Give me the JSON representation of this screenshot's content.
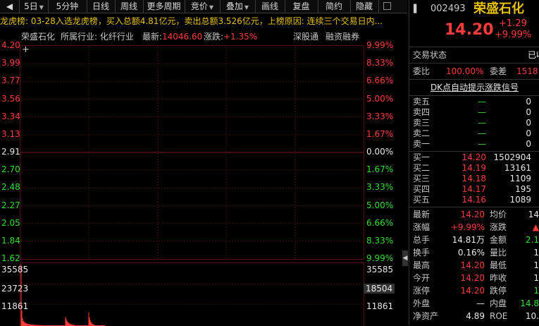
{
  "toolbar": {
    "items": [
      {
        "label": "5日",
        "has_arrow": true
      },
      {
        "label": "5分钟",
        "has_arrow": false
      },
      {
        "label": "日线",
        "has_arrow": false
      },
      {
        "label": "周线",
        "has_arrow": false
      },
      {
        "label": "更多周期",
        "has_arrow": false
      },
      {
        "label": "竞价",
        "has_arrow": true
      },
      {
        "label": "叠加",
        "has_arrow": true
      },
      {
        "label": "画线",
        "has_arrow": false
      },
      {
        "label": "复盘",
        "has_arrow": false
      },
      {
        "label": "简约",
        "has_arrow": false
      },
      {
        "label": "隐藏",
        "has_arrow": false
      }
    ]
  },
  "ticker_text": "龙虎榜: 03-28入选龙虎榜，买入总额4.81亿元，卖出总额3.526亿元，上榜原因: 连续三个交易日内...",
  "header": {
    "stock_name": "荣盛石化",
    "industry_label": "所属行业: 化纤行业",
    "latest_label": "最新:",
    "latest_value": "14046.60",
    "change_label": "涨跌:",
    "change_value": "+1.35%",
    "link1": "深股通",
    "link2": "融资融券"
  },
  "chart_data": {
    "type": "line",
    "title": "",
    "prev_close": 2.91,
    "y_left_ticks": [
      "4.20",
      "3.99",
      "3.77",
      "3.56",
      "3.34",
      "3.13",
      "2.91",
      "2.70",
      "2.48",
      "2.27",
      "2.05",
      "1.84",
      "1.62"
    ],
    "y_right_ticks": [
      "9.99%",
      "8.33%",
      "6.66%",
      "5.00%",
      "3.33%",
      "1.67%",
      "0.00%",
      "1.67%",
      "3.33%",
      "5.00%",
      "6.66%",
      "8.33%",
      "9.99%"
    ],
    "ylim": [
      1.62,
      4.2
    ],
    "volume": {
      "left_ticks": [
        "35585",
        "23723",
        "11861"
      ],
      "right_ticks": [
        "35585",
        "18504",
        "11861"
      ],
      "ylim": [
        0,
        35585
      ],
      "bars": [
        35585,
        9000,
        4500,
        3000,
        2800,
        2200,
        1800,
        1600,
        1500,
        1300,
        1200,
        1100,
        1000,
        950,
        900,
        850,
        800,
        760,
        700,
        680,
        650,
        620,
        600,
        580,
        560,
        540,
        520,
        500,
        480,
        470,
        460,
        450,
        440,
        430,
        420,
        410,
        400,
        390,
        380,
        370,
        360,
        350,
        340,
        330,
        320,
        310,
        300,
        290,
        280,
        270,
        260,
        250,
        240,
        230,
        220,
        210,
        200,
        190,
        180,
        170,
        160,
        150,
        140,
        5200,
        4100,
        3100,
        2500,
        2000,
        1700,
        1400,
        1200,
        1000,
        900,
        800,
        700,
        600,
        500,
        420,
        380,
        340,
        300,
        280,
        260,
        240,
        220,
        200,
        190,
        180,
        170,
        160,
        150,
        140,
        130,
        120,
        110,
        100,
        8000,
        5000,
        3500,
        2500,
        1800,
        1300,
        1000,
        800,
        600,
        500,
        400,
        350,
        300,
        250,
        200,
        180,
        160,
        140,
        120,
        100,
        90,
        80,
        70,
        60
      ]
    }
  },
  "quote": {
    "code": "002493",
    "name": "荣盛石化",
    "price": "14.20",
    "change": "+1.29",
    "change_pct": "+9.99%",
    "status_label": "交易状态",
    "status_value": "已收盘",
    "weibi_label": "委比",
    "weibi_value": "100.00%",
    "weicha_label": "委差",
    "weicha_value": "1518",
    "dk_banner": "DK点自动提示涨跌信号"
  },
  "sell_orders": [
    {
      "label": "卖五",
      "price": "—",
      "vol": "0"
    },
    {
      "label": "卖四",
      "price": "—",
      "vol": "0"
    },
    {
      "label": "卖三",
      "price": "—",
      "vol": "0"
    },
    {
      "label": "卖二",
      "price": "—",
      "vol": "0"
    },
    {
      "label": "卖一",
      "price": "—",
      "vol": "0"
    }
  ],
  "buy_orders": [
    {
      "label": "买一",
      "price": "14.20",
      "vol": "1502904"
    },
    {
      "label": "买二",
      "price": "14.19",
      "vol": "13161"
    },
    {
      "label": "买三",
      "price": "14.18",
      "vol": "1109"
    },
    {
      "label": "买四",
      "price": "14.17",
      "vol": "195"
    },
    {
      "label": "买五",
      "price": "14.16",
      "vol": "1089"
    }
  ],
  "stats": [
    {
      "l1": "最新",
      "v1": "14.20",
      "c1": "red",
      "l2": "均价",
      "v2": "14",
      "c2": "white"
    },
    {
      "l1": "涨幅",
      "v1": "+9.99%",
      "c1": "red",
      "l2": "涨跌",
      "v2": "▲",
      "c2": "red"
    },
    {
      "l1": "总手",
      "v1": "14.81万",
      "c1": "white",
      "l2": "金额",
      "v2": "2.1",
      "c2": "green"
    },
    {
      "l1": "换手",
      "v1": "0.16%",
      "c1": "white",
      "l2": "量比",
      "v2": "1",
      "c2": "white"
    },
    {
      "l1": "最高",
      "v1": "14.20",
      "c1": "red",
      "l2": "最低",
      "v2": "1",
      "c2": "white"
    },
    {
      "l1": "今开",
      "v1": "14.20",
      "c1": "red",
      "l2": "昨收",
      "v2": "1",
      "c2": "white"
    },
    {
      "l1": "涨停",
      "v1": "14.20",
      "c1": "red",
      "l2": "跌停",
      "v2": "1",
      "c2": "green"
    },
    {
      "l1": "外盘",
      "v1": "—",
      "c1": "white",
      "l2": "内盘",
      "v2": "14.8",
      "c2": "green"
    },
    {
      "l1": "净资产",
      "v1": "4.89",
      "c1": "white",
      "l2": "ROE",
      "v2": "10.",
      "c2": "white"
    }
  ],
  "colors": {
    "up": "#ff3b3b",
    "down": "#2fe02f",
    "flat": "#e8e8e8",
    "grid": "#5a1010"
  }
}
